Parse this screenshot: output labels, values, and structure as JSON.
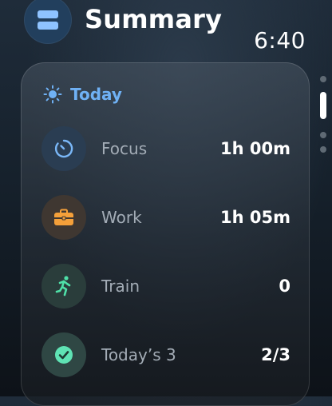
{
  "header": {
    "title": "Summary",
    "time": "6:40",
    "menu_icon": "stack-icon"
  },
  "card": {
    "title": "Today",
    "title_icon": "sun-icon",
    "rows": [
      {
        "label": "Focus",
        "value": "1h 00m",
        "icon": "timer-icon",
        "color": "#7ab7f7"
      },
      {
        "label": "Work",
        "value": "1h 05m",
        "icon": "briefcase-icon",
        "color": "#f5a03a"
      },
      {
        "label": "Train",
        "value": "0",
        "icon": "running-figure-icon",
        "color": "#4fe0a8"
      },
      {
        "label": "Today’s 3",
        "value": "2/3",
        "icon": "checkmark-icon",
        "color": "#5fe3b4"
      }
    ]
  },
  "colors": {
    "accent": "#6fb1f5",
    "label_gray": "#a3acb6"
  }
}
